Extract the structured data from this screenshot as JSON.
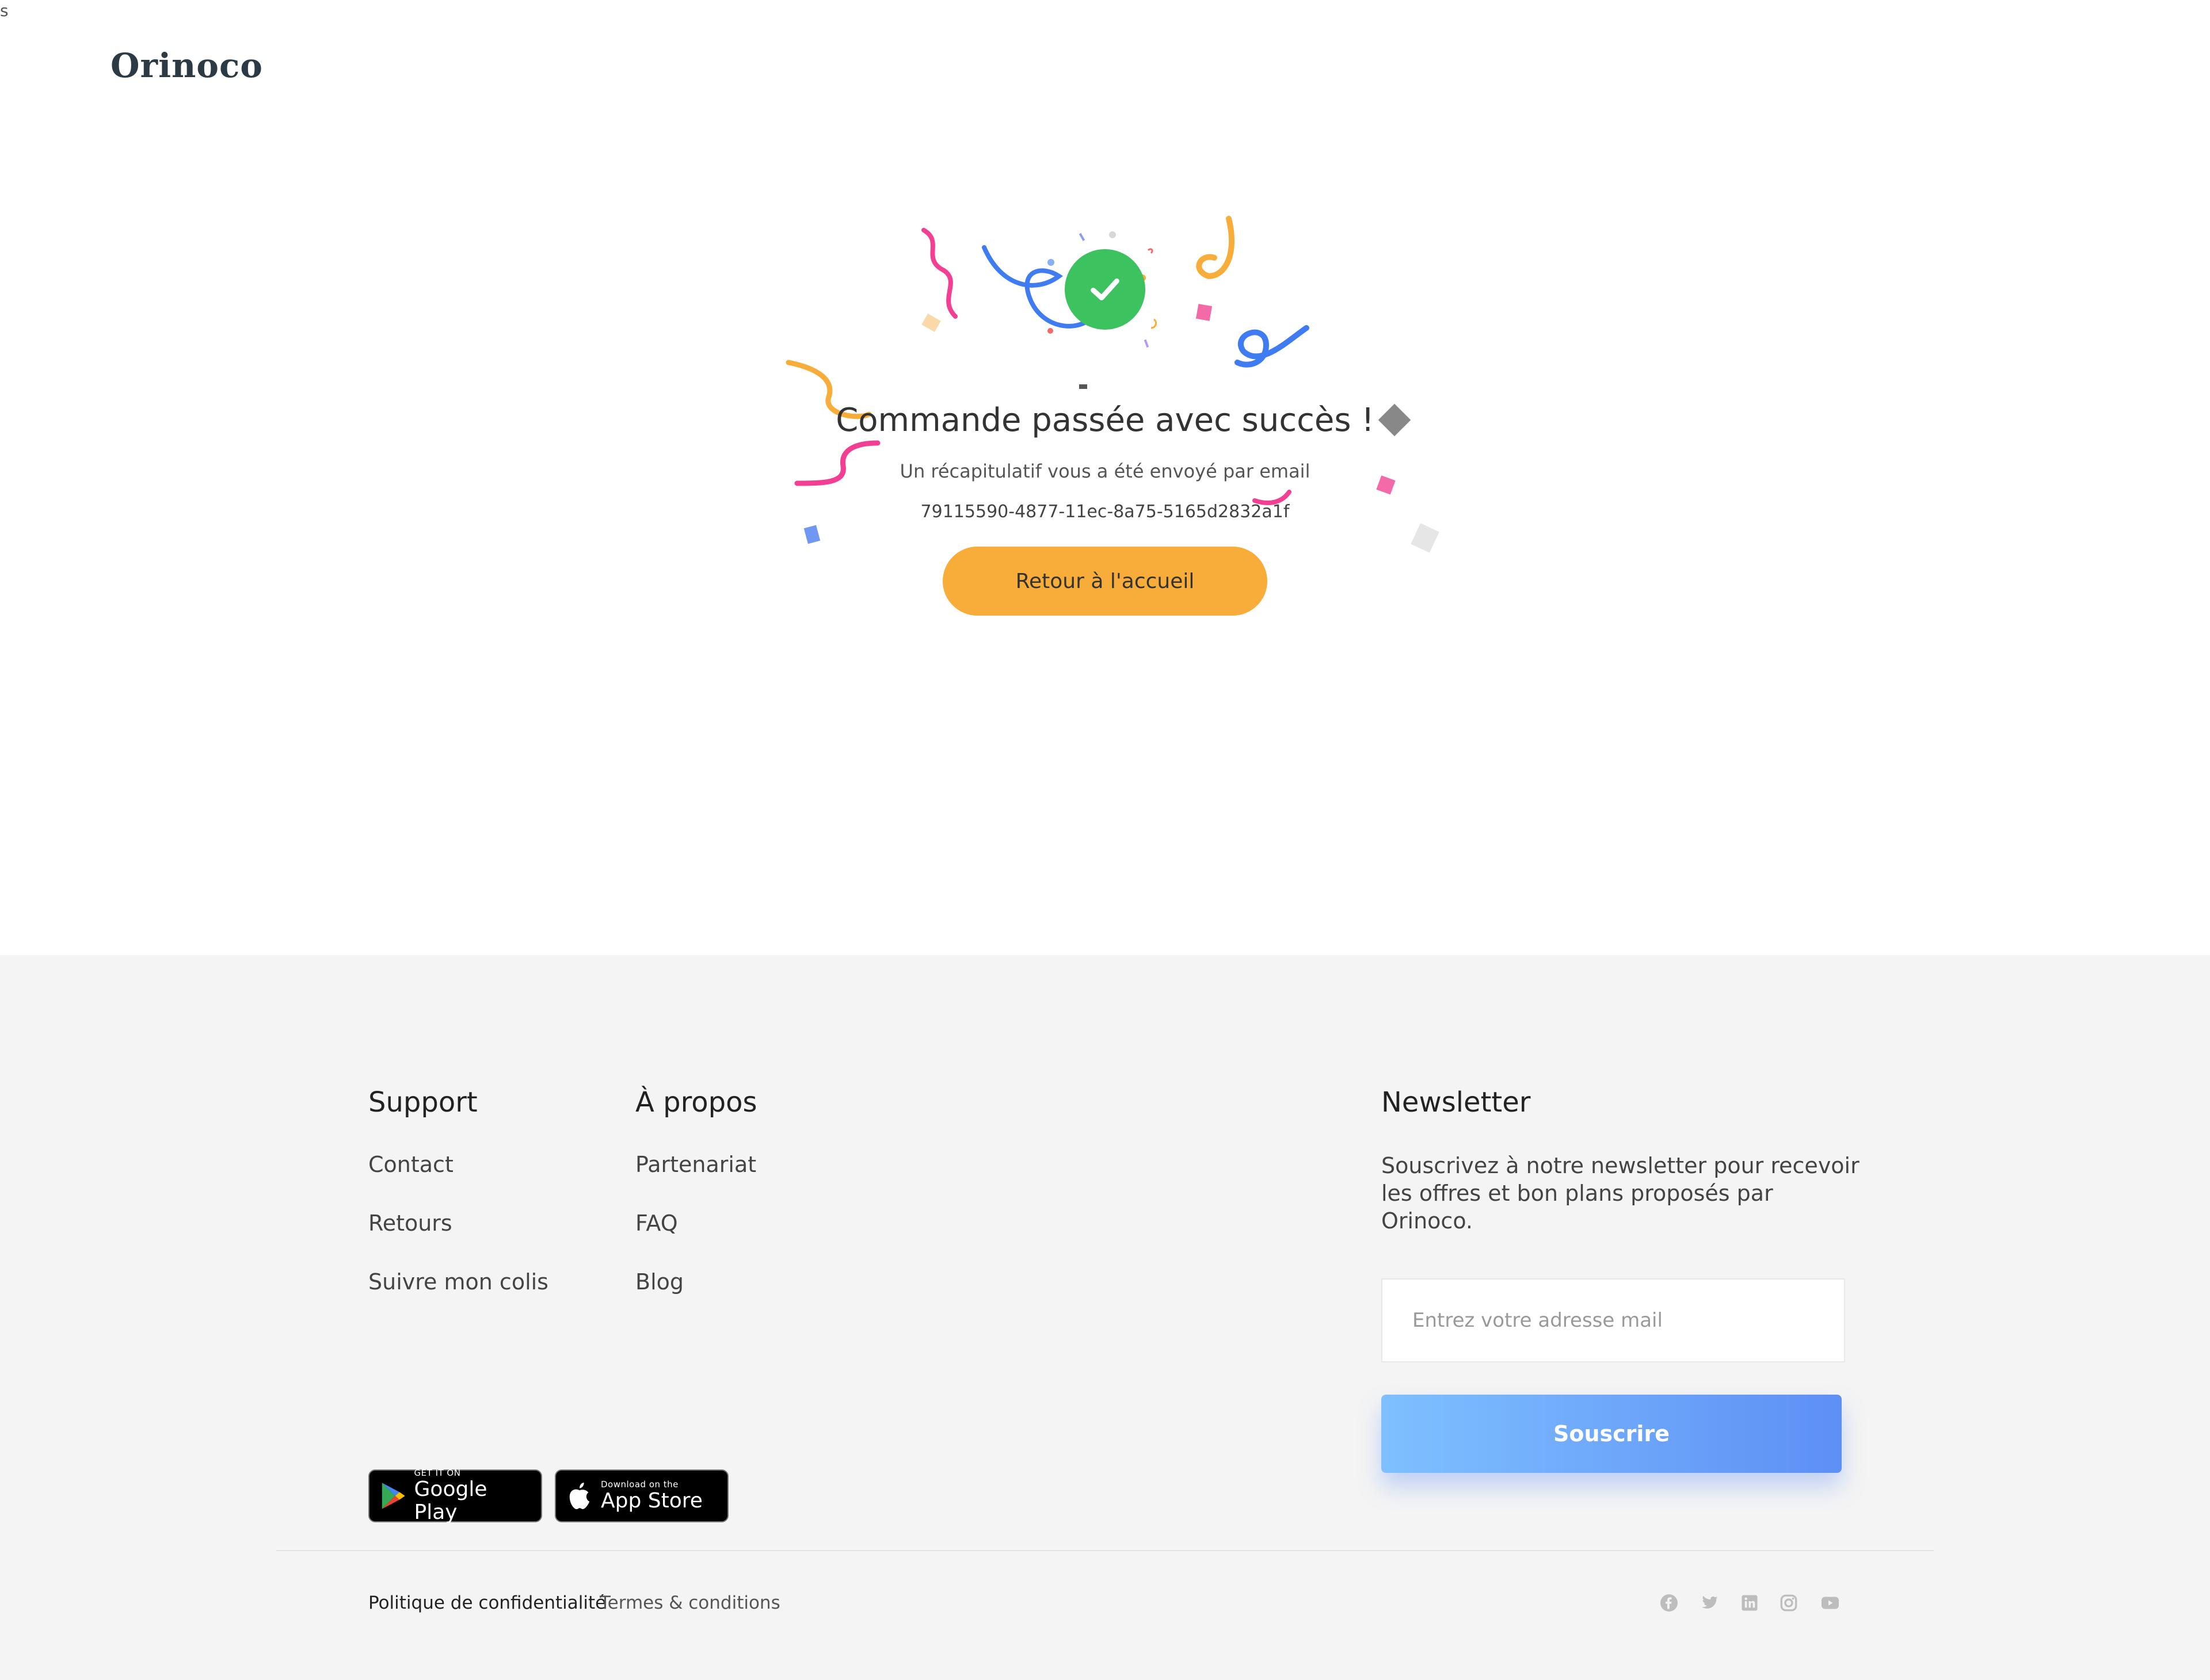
{
  "stray_char": "s",
  "header": {
    "logo": "Orinoco"
  },
  "confirmation": {
    "icon": "check-icon",
    "title": "Commande passée avec succès !",
    "subtitle": "Un récapitulatif vous a été envoyé par email",
    "order_id": "79115590-4877-11ec-8a75-5165d2832a1f",
    "home_button": "Retour à l'accueil",
    "colors": {
      "check": "#3cc25e",
      "button": "#f8ad3b"
    }
  },
  "footer": {
    "support": {
      "title": "Support",
      "links": [
        "Contact",
        "Retours",
        "Suivre mon colis"
      ]
    },
    "about": {
      "title": "À propos",
      "links": [
        "Partenariat",
        "FAQ",
        "Blog"
      ]
    },
    "newsletter": {
      "title": "Newsletter",
      "text": "Souscrivez à notre newsletter pour recevoir les offres et bon plans proposés par Orinoco.",
      "input_placeholder": "Entrez votre adresse mail",
      "input_value": "",
      "button": "Souscrire"
    },
    "badges": {
      "google": {
        "small": "GET IT ON",
        "big": "Google Play"
      },
      "apple": {
        "small": "Download on the",
        "big": "App Store"
      }
    },
    "legal": {
      "privacy": "Politique de confidentialité",
      "terms": "Termes & conditions"
    },
    "social_icons": [
      "facebook-icon",
      "twitter-icon",
      "linkedin-icon",
      "instagram-icon",
      "youtube-icon"
    ]
  }
}
